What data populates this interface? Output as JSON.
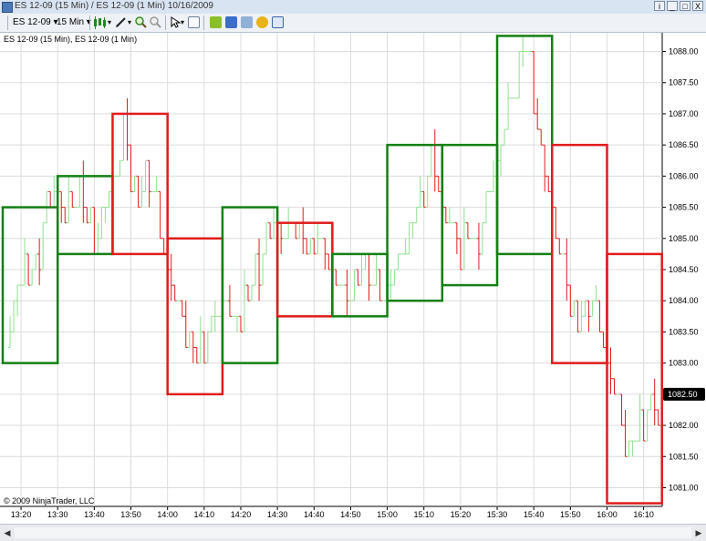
{
  "window": {
    "title": "ES 12-09 (15 Min) / ES 12-09 (1 Min)  10/16/2009",
    "buttons": [
      "i",
      "_",
      "□",
      "X"
    ]
  },
  "toolbar": {
    "instrument": "ES 12-09",
    "interval": "15 Min",
    "icons": [
      "candlestick-style-icon",
      "pencil-draw-icon",
      "zoom-in-icon",
      "zoom-out-icon",
      "pointer-icon",
      "properties-icon",
      "strategy-icon",
      "chart-icon",
      "indicator-icon",
      "coin-icon",
      "window-icon"
    ]
  },
  "chart": {
    "caption": "ES 12-09 (15 Min), ES 12-09 (1 Min)",
    "copyright": "© 2009 NinjaTrader, LLC",
    "price_tag": "1082.50"
  },
  "chart_data": {
    "type": "candlestick",
    "title": "ES 12-09 (15 Min), ES 12-09 (1 Min)",
    "x_ticks": [
      "13:20",
      "13:30",
      "13:40",
      "13:50",
      "14:00",
      "14:10",
      "14:20",
      "14:30",
      "14:40",
      "14:50",
      "15:00",
      "15:10",
      "15:20",
      "15:30",
      "15:40",
      "15:50",
      "16:00",
      "16:10"
    ],
    "y_ticks": [
      "1081.00",
      "1081.50",
      "1082.00",
      "1082.50",
      "1083.00",
      "1083.50",
      "1084.00",
      "1084.50",
      "1085.00",
      "1085.50",
      "1086.00",
      "1086.50",
      "1087.00",
      "1087.50",
      "1088.00"
    ],
    "ylim": [
      1080.7,
      1088.3
    ],
    "grid": true,
    "last_price": 1082.5,
    "colors": {
      "up": "#138013",
      "down": "#e11b1b",
      "minute_up": "#8fe08f",
      "minute_down": "#e11b1b"
    },
    "bars_15min": [
      {
        "start": "13:15",
        "end": "13:30",
        "open": 1083.0,
        "close": 1085.5,
        "direction": "up"
      },
      {
        "start": "13:30",
        "end": "13:45",
        "open": 1084.75,
        "close": 1086.0,
        "direction": "up"
      },
      {
        "start": "13:45",
        "end": "14:00",
        "open": 1087.0,
        "close": 1084.75,
        "direction": "down"
      },
      {
        "start": "14:00",
        "end": "14:15",
        "open": 1085.0,
        "close": 1082.5,
        "direction": "down"
      },
      {
        "start": "14:15",
        "end": "14:30",
        "open": 1083.0,
        "close": 1085.5,
        "direction": "up"
      },
      {
        "start": "14:30",
        "end": "14:45",
        "open": 1085.25,
        "close": 1083.75,
        "direction": "down"
      },
      {
        "start": "14:45",
        "end": "15:00",
        "open": 1083.75,
        "close": 1084.75,
        "direction": "up"
      },
      {
        "start": "15:00",
        "end": "15:15",
        "open": 1084.0,
        "close": 1086.5,
        "direction": "up"
      },
      {
        "start": "15:15",
        "end": "15:30",
        "open": 1084.25,
        "close": 1086.5,
        "direction": "up"
      },
      {
        "start": "15:30",
        "end": "15:45",
        "open": 1084.75,
        "close": 1088.25,
        "direction": "up"
      },
      {
        "start": "15:45",
        "end": "16:00",
        "open": 1086.5,
        "close": 1083.0,
        "direction": "down"
      },
      {
        "start": "16:00",
        "end": "16:15",
        "open": 1084.75,
        "close": 1080.75,
        "direction": "down"
      }
    ],
    "minute_anchors": [
      [
        0,
        1083.25
      ],
      [
        2,
        1083.75
      ],
      [
        4,
        1084.5
      ],
      [
        6,
        1084.25
      ],
      [
        8,
        1084.5
      ],
      [
        11,
        1085.5
      ],
      [
        14,
        1085.75
      ],
      [
        16,
        1085.25
      ],
      [
        18,
        1085.5
      ],
      [
        20,
        1085.75
      ],
      [
        22,
        1085.25
      ],
      [
        25,
        1085.0
      ],
      [
        28,
        1085.75
      ],
      [
        31,
        1086.25
      ],
      [
        32,
        1086.75
      ],
      [
        34,
        1086.0
      ],
      [
        36,
        1085.5
      ],
      [
        38,
        1086.0
      ],
      [
        40,
        1085.75
      ],
      [
        42,
        1085.0
      ],
      [
        44,
        1084.5
      ],
      [
        46,
        1084.0
      ],
      [
        49,
        1083.5
      ],
      [
        52,
        1083.0
      ],
      [
        54,
        1083.25
      ],
      [
        57,
        1083.75
      ],
      [
        60,
        1084.0
      ],
      [
        62,
        1083.5
      ],
      [
        64,
        1083.75
      ],
      [
        67,
        1084.25
      ],
      [
        70,
        1084.75
      ],
      [
        73,
        1085.25
      ],
      [
        76,
        1085.0
      ],
      [
        79,
        1085.25
      ],
      [
        82,
        1084.75
      ],
      [
        85,
        1085.0
      ],
      [
        88,
        1084.5
      ],
      [
        90,
        1084.25
      ],
      [
        92,
        1084.0
      ],
      [
        95,
        1084.25
      ],
      [
        98,
        1084.5
      ],
      [
        100,
        1084.25
      ],
      [
        102,
        1084.0
      ],
      [
        105,
        1084.25
      ],
      [
        108,
        1084.75
      ],
      [
        111,
        1085.25
      ],
      [
        114,
        1085.75
      ],
      [
        116,
        1086.25
      ],
      [
        118,
        1085.75
      ],
      [
        120,
        1085.25
      ],
      [
        122,
        1085.0
      ],
      [
        124,
        1084.75
      ],
      [
        126,
        1085.0
      ],
      [
        128,
        1084.75
      ],
      [
        130,
        1085.25
      ],
      [
        132,
        1085.75
      ],
      [
        134,
        1086.25
      ],
      [
        136,
        1086.75
      ],
      [
        138,
        1087.25
      ],
      [
        140,
        1087.75
      ],
      [
        142,
        1088.0
      ],
      [
        144,
        1087.25
      ],
      [
        146,
        1086.25
      ],
      [
        148,
        1085.75
      ],
      [
        150,
        1085.0
      ],
      [
        152,
        1084.5
      ],
      [
        154,
        1084.0
      ],
      [
        156,
        1083.5
      ],
      [
        158,
        1083.75
      ],
      [
        160,
        1084.0
      ],
      [
        162,
        1083.5
      ],
      [
        164,
        1083.0
      ],
      [
        166,
        1082.5
      ],
      [
        168,
        1082.0
      ],
      [
        170,
        1081.5
      ],
      [
        172,
        1081.75
      ],
      [
        174,
        1082.0
      ],
      [
        176,
        1082.25
      ],
      [
        178,
        1082.0
      ],
      [
        179,
        1082.5
      ]
    ]
  }
}
